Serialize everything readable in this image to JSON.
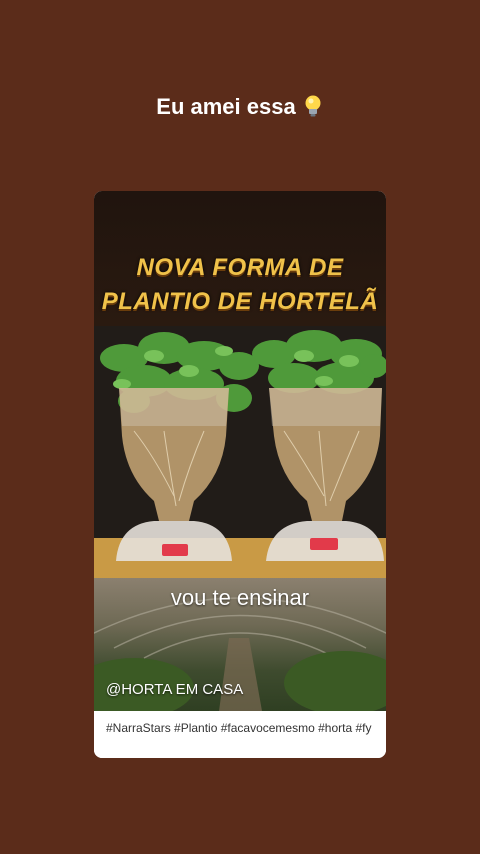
{
  "story": {
    "caption": "Eu amei essa",
    "caption_icon": "light-bulb-icon"
  },
  "post": {
    "headline_line1": "NOVA FORMA DE",
    "headline_line2": "PLANTIO DE HORTELÃ",
    "subtitle": "vou te ensinar",
    "handle": "@HORTA EM CASA",
    "hashtags": "#NarraStars #Plantio #facavocemesmo #horta #fy"
  },
  "colors": {
    "background": "#5b2c1a",
    "headline": "#f0c24a"
  }
}
